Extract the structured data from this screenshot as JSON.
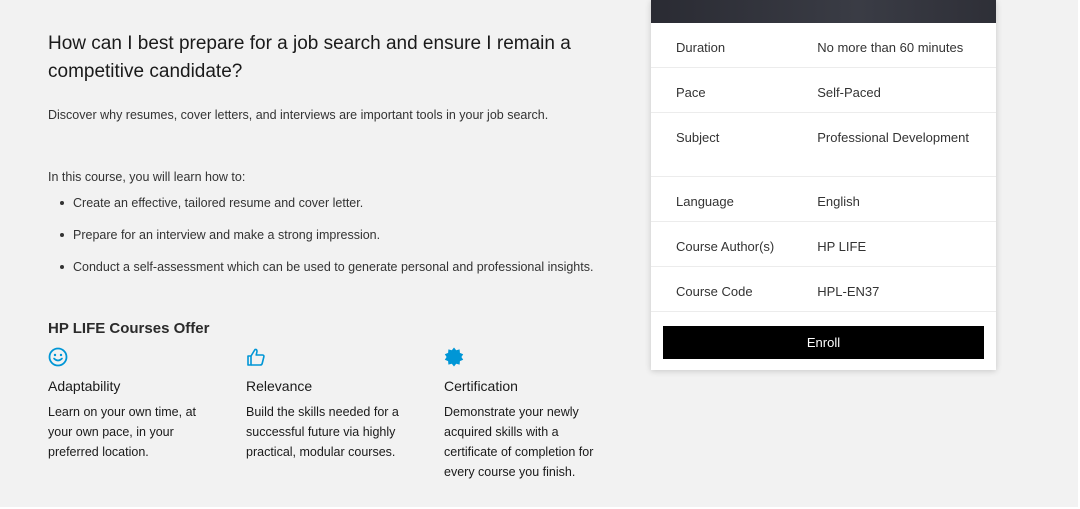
{
  "main": {
    "question": "How can I best prepare for a job search and ensure I remain a competitive candidate?",
    "intro": "Discover why resumes, cover letters, and interviews are important tools in your job search.",
    "learn_lead": "In this course, you will learn how to:",
    "bullets": [
      "Create an effective, tailored resume and cover letter.",
      "Prepare for an interview and make a strong impression.",
      "Conduct a self-assessment which can be used to generate personal and professional insights."
    ]
  },
  "offers": {
    "title": "HP LIFE Courses Offer",
    "accent_color": "#0096d6",
    "items": [
      {
        "icon": "smiley-icon",
        "title": "Adaptability",
        "desc": "Learn on your own time, at your own pace, in your preferred location."
      },
      {
        "icon": "thumbs-up-icon",
        "title": "Relevance",
        "desc": "Build the skills needed for a successful future via highly practical, modular courses."
      },
      {
        "icon": "certificate-badge-icon",
        "title": "Certification",
        "desc": "Demonstrate your newly acquired skills with a certificate of completion for every course you finish."
      }
    ]
  },
  "course_card": {
    "details": [
      {
        "label": "Duration",
        "value": "No more than 60 minutes"
      },
      {
        "label": "Pace",
        "value": "Self-Paced"
      },
      {
        "label": "Subject",
        "value": "Professional Development"
      },
      {
        "label": "Language",
        "value": "English"
      },
      {
        "label": "Course Author(s)",
        "value": "HP LIFE"
      },
      {
        "label": "Course Code",
        "value": "HPL-EN37"
      }
    ],
    "enroll_label": "Enroll"
  }
}
